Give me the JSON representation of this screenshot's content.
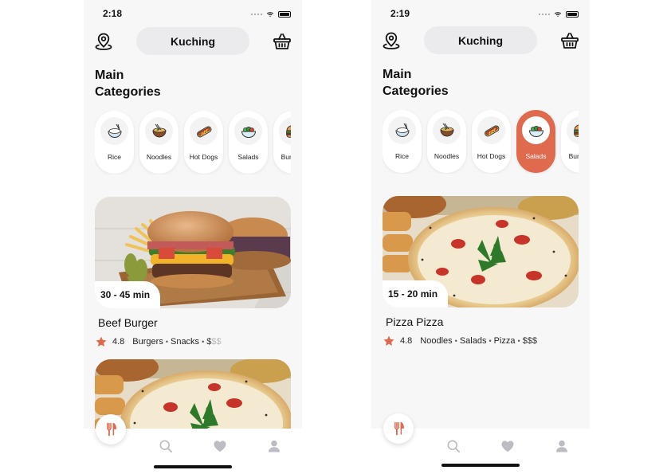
{
  "colors": {
    "accent": "#e06a4e",
    "pill": "#ebebee",
    "background": "#f7f7f8"
  },
  "screens": [
    {
      "status": {
        "time": "2:18"
      },
      "header": {
        "location": "Kuching",
        "location_icon": "map-pin-icon",
        "cart_icon": "basket-icon"
      },
      "section": {
        "line1": "Main",
        "line2": "Categories"
      },
      "categories": [
        {
          "label": "Rice",
          "icon": "rice-bowl-icon"
        },
        {
          "label": "Noodles",
          "icon": "noodles-bowl-icon"
        },
        {
          "label": "Hot Dogs",
          "icon": "hot-dog-icon"
        },
        {
          "label": "Salads",
          "icon": "salad-bowl-icon"
        },
        {
          "label": "Burgers",
          "icon": "burger-icon"
        }
      ],
      "selected_category": "",
      "restaurant": {
        "eta": "30 - 45 min",
        "name": "Beef Burger",
        "rating": "4.8",
        "tags": [
          "Burgers",
          "Snacks"
        ],
        "price_active": "$",
        "price_inactive": "$$"
      },
      "tabs": [
        "restaurants-icon",
        "search-icon",
        "heart-icon",
        "profile-icon"
      ]
    },
    {
      "status": {
        "time": "2:19"
      },
      "header": {
        "location": "Kuching",
        "location_icon": "map-pin-icon",
        "cart_icon": "basket-icon"
      },
      "section": {
        "line1": "Main",
        "line2": "Categories"
      },
      "categories": [
        {
          "label": "Rice",
          "icon": "rice-bowl-icon"
        },
        {
          "label": "Noodles",
          "icon": "noodles-bowl-icon"
        },
        {
          "label": "Hot Dogs",
          "icon": "hot-dog-icon"
        },
        {
          "label": "Salads",
          "icon": "salad-bowl-icon"
        },
        {
          "label": "Burgers",
          "icon": "burger-icon"
        }
      ],
      "selected_category": "Salads",
      "restaurant": {
        "eta": "15 - 20 min",
        "name": "Pizza Pizza",
        "rating": "4.8",
        "tags": [
          "Noodles",
          "Salads",
          "Pizza"
        ],
        "price_active": "$$$",
        "price_inactive": ""
      },
      "tabs": [
        "restaurants-icon",
        "search-icon",
        "heart-icon",
        "profile-icon"
      ]
    }
  ]
}
